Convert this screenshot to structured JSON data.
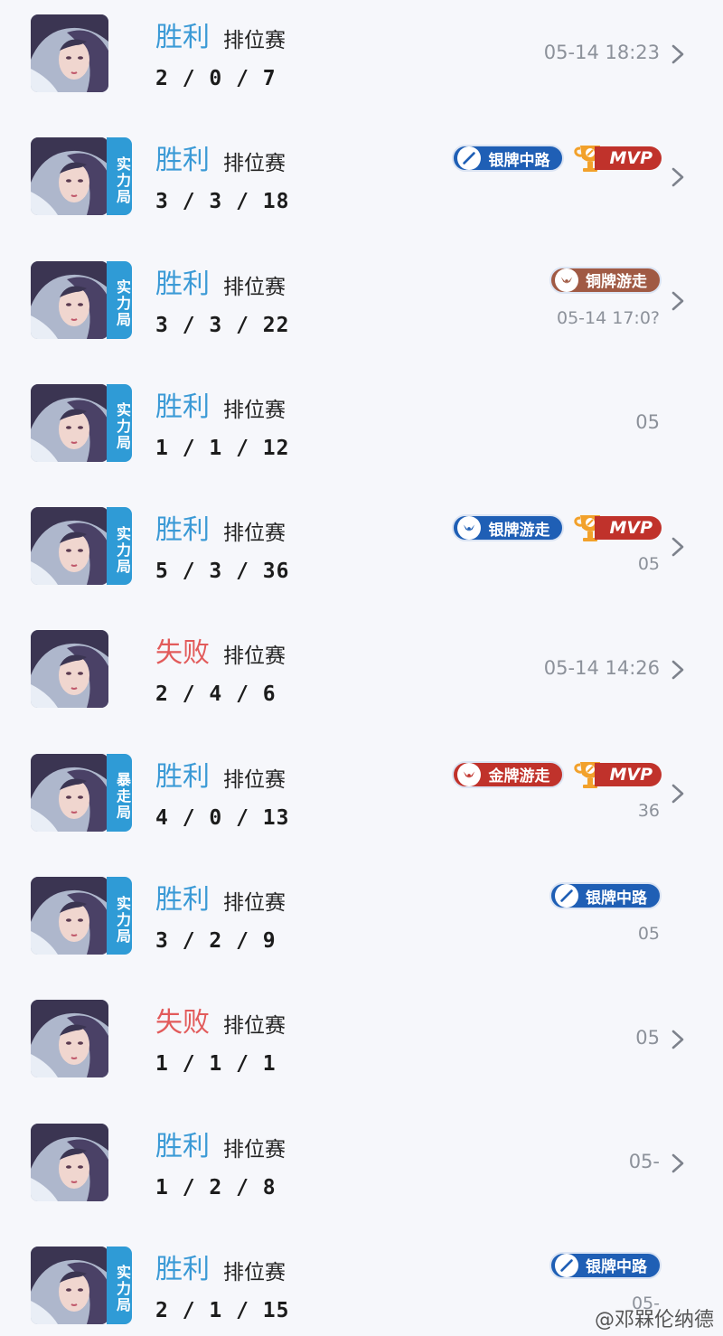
{
  "matches": [
    {
      "result": "胜利",
      "type": "排位赛",
      "kda": "2 / 0 / 7",
      "tag": "",
      "time": "05-14 18:23",
      "badges": [],
      "mvp": false,
      "lose": false,
      "chevron": true
    },
    {
      "result": "胜利",
      "type": "排位赛",
      "kda": "3 / 3 / 18",
      "tag": "实力局",
      "time": "",
      "badges": [
        {
          "label": "银牌中路",
          "kind": "silver",
          "icon": "sword-icon"
        }
      ],
      "mvp": true,
      "lose": false,
      "chevron": true
    },
    {
      "result": "胜利",
      "type": "排位赛",
      "kda": "3 / 3 / 22",
      "tag": "实力局",
      "time": "05-14 17:0?",
      "badges": [
        {
          "label": "铜牌游走",
          "kind": "bronze",
          "icon": "wings-icon"
        }
      ],
      "mvp": false,
      "lose": false,
      "chevron": true
    },
    {
      "result": "胜利",
      "type": "排位赛",
      "kda": "1 / 1 / 12",
      "tag": "实力局",
      "time": "05",
      "badges": [],
      "mvp": false,
      "lose": false,
      "chevron": false
    },
    {
      "result": "胜利",
      "type": "排位赛",
      "kda": "5 / 3 / 36",
      "tag": "实力局",
      "time": "05",
      "badges": [
        {
          "label": "银牌游走",
          "kind": "silver",
          "icon": "wings-icon"
        }
      ],
      "mvp": true,
      "lose": false,
      "chevron": true
    },
    {
      "result": "失败",
      "type": "排位赛",
      "kda": "2 / 4 / 6",
      "tag": "",
      "time": "05-14 14:26",
      "badges": [],
      "mvp": false,
      "lose": true,
      "chevron": true
    },
    {
      "result": "胜利",
      "type": "排位赛",
      "kda": "4 / 0 / 13",
      "tag": "暴走局",
      "time": "36",
      "badges": [
        {
          "label": "金牌游走",
          "kind": "gold",
          "icon": "wings-icon"
        }
      ],
      "mvp": true,
      "lose": false,
      "chevron": true
    },
    {
      "result": "胜利",
      "type": "排位赛",
      "kda": "3 / 2 / 9",
      "tag": "实力局",
      "time": "05",
      "badges": [
        {
          "label": "银牌中路",
          "kind": "silver",
          "icon": "sword-icon"
        }
      ],
      "mvp": false,
      "lose": false,
      "chevron": false
    },
    {
      "result": "失败",
      "type": "排位赛",
      "kda": "1 / 1 / 1",
      "tag": "",
      "time": "05",
      "badges": [],
      "mvp": false,
      "lose": true,
      "chevron": true
    },
    {
      "result": "胜利",
      "type": "排位赛",
      "kda": "1 / 2 / 8",
      "tag": "",
      "time": "05-",
      "badges": [],
      "mvp": false,
      "lose": false,
      "chevron": true
    },
    {
      "result": "胜利",
      "type": "排位赛",
      "kda": "2 / 1 / 15",
      "tag": "实力局",
      "time": "05-",
      "badges": [
        {
          "label": "银牌中路",
          "kind": "silver",
          "icon": "sword-icon"
        }
      ],
      "mvp": false,
      "lose": false,
      "chevron": false
    }
  ],
  "mvp_label": "MVP",
  "watermark": "@邓槑伦纳德",
  "colors": {
    "win": "#3b9ad6",
    "lose": "#e25b5b",
    "tag": "#2f9bd6",
    "silver": "#1f5fb5",
    "bronze": "#a05a44",
    "gold": "#c0322b"
  }
}
